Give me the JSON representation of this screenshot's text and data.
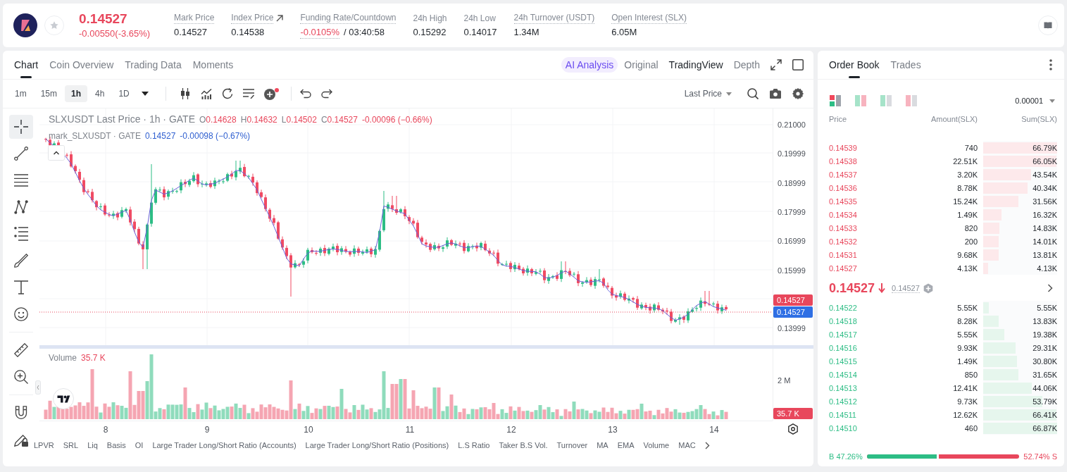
{
  "ticker": {
    "favorite": false,
    "price": "0.14527",
    "change": "-0.00550(-3.65%)",
    "stats": [
      {
        "label": "Mark Price",
        "value": "0.14527",
        "tooltip": true,
        "kind": "plain"
      },
      {
        "label": "Index Price",
        "value": "0.14538",
        "tooltip": true,
        "kind": "link"
      },
      {
        "label": "Funding Rate/Countdown",
        "rate": "-0.0105%",
        "value": "/ 03:40:58",
        "tooltip": true,
        "kind": "funding"
      },
      {
        "label": "24h High",
        "value": "0.15292",
        "tooltip": false,
        "kind": "plain"
      },
      {
        "label": "24h Low",
        "value": "0.14017",
        "tooltip": false,
        "kind": "plain"
      },
      {
        "label": "24h Turnover (USDT)",
        "value": "1.34M",
        "tooltip": true,
        "kind": "plain"
      },
      {
        "label": "Open Interest (SLX)",
        "value": "6.05M",
        "tooltip": true,
        "kind": "plain"
      }
    ]
  },
  "chart_panel": {
    "tabs": [
      {
        "label": "Chart",
        "selected": true
      },
      {
        "label": "Coin Overview",
        "selected": false
      },
      {
        "label": "Trading Data",
        "selected": false
      },
      {
        "label": "Moments",
        "selected": false
      }
    ],
    "views": [
      {
        "label": "AI Analysis",
        "kind": "ai",
        "selected": false
      },
      {
        "label": "Original",
        "kind": "plain",
        "selected": false
      },
      {
        "label": "TradingView",
        "kind": "plain",
        "selected": true
      },
      {
        "label": "Depth",
        "kind": "plain",
        "selected": false
      }
    ],
    "intervals": [
      {
        "label": "1m",
        "selected": false
      },
      {
        "label": "15m",
        "selected": false
      },
      {
        "label": "1h",
        "selected": true
      },
      {
        "label": "4h",
        "selected": false
      },
      {
        "label": "1D",
        "selected": false
      }
    ],
    "price_source": "Last Price",
    "tool_groups": [
      {
        "tools": [
          {
            "kind": "crosshair",
            "selected": true
          },
          {
            "kind": "trend_line",
            "selected": false
          },
          {
            "kind": "horizontal_lines",
            "selected": false
          },
          {
            "kind": "pattern",
            "selected": false
          },
          {
            "kind": "fib_levels",
            "selected": false
          },
          {
            "kind": "brush",
            "selected": false
          },
          {
            "kind": "text",
            "selected": false
          },
          {
            "kind": "emoji",
            "selected": false
          }
        ]
      },
      {
        "tools": [
          {
            "kind": "ruler",
            "selected": false
          },
          {
            "kind": "zoom",
            "selected": false
          }
        ]
      },
      {
        "tools": [
          {
            "kind": "magnet",
            "selected": false
          },
          {
            "kind": "lock_drawing",
            "selected": false
          }
        ]
      }
    ],
    "legend": {
      "title": "SLXUSDT Last Price · 1h · GATE",
      "ohlc": [
        {
          "key": "O",
          "value": "0.14628"
        },
        {
          "key": "H",
          "value": "0.14632"
        },
        {
          "key": "L",
          "value": "0.14502"
        },
        {
          "key": "C",
          "value": "0.14527"
        }
      ],
      "change": "-0.00096 (−0.66%)",
      "mark_title": "mark_SLXUSDT · GATE",
      "mark_value": "0.14527",
      "mark_change": "-0.00098 (−0.67%)"
    },
    "price_axis": [
      "0.21000",
      "0.19999",
      "0.18999",
      "0.17999",
      "0.16999",
      "0.15999",
      "0.13999"
    ],
    "price_tags": [
      {
        "kind": "last",
        "value": "0.14527"
      },
      {
        "kind": "mark",
        "value": "0.14527"
      }
    ],
    "volume": {
      "label": "Volume",
      "value": "35.7 K",
      "axis_label": "2 M",
      "tag": "35.7 K"
    },
    "date_axis": [
      "8",
      "9",
      "10",
      "11",
      "12",
      "13",
      "14"
    ],
    "indicators": [
      "LPVR",
      "SRL",
      "Liq",
      "Basis",
      "OI",
      "Large Trader Long/Short Ratio (Accounts)",
      "Large Trader Long/Short Ratio (Positions)",
      "L.S Ratio",
      "Taker B.S Vol.",
      "Turnover",
      "MA",
      "EMA",
      "Volume",
      "MAC"
    ]
  },
  "order_book": {
    "tabs": [
      {
        "label": "Order Book",
        "selected": true
      },
      {
        "label": "Trades",
        "selected": false
      }
    ],
    "view_modes": [
      {
        "kind": "both",
        "selected": true
      },
      {
        "kind": "columns",
        "selected": false
      },
      {
        "kind": "bids",
        "selected": false
      },
      {
        "kind": "asks",
        "selected": false
      }
    ],
    "precision": "0.00001",
    "columns": [
      "Price",
      "Amount(SLX)",
      "Sum(SLX)"
    ],
    "asks": [
      {
        "price": "0.14539",
        "amount": "740",
        "sum": "66.79K",
        "level": 0.999
      },
      {
        "price": "0.14538",
        "amount": "22.51K",
        "sum": "66.05K",
        "level": 0.988
      },
      {
        "price": "0.14537",
        "amount": "3.20K",
        "sum": "43.54K",
        "level": 0.651
      },
      {
        "price": "0.14536",
        "amount": "8.78K",
        "sum": "40.34K",
        "level": 0.603
      },
      {
        "price": "0.14535",
        "amount": "15.24K",
        "sum": "31.56K",
        "level": 0.472
      },
      {
        "price": "0.14534",
        "amount": "1.49K",
        "sum": "16.32K",
        "level": 0.244
      },
      {
        "price": "0.14533",
        "amount": "820",
        "sum": "14.83K",
        "level": 0.222
      },
      {
        "price": "0.14532",
        "amount": "200",
        "sum": "14.01K",
        "level": 0.21
      },
      {
        "price": "0.14531",
        "amount": "9.68K",
        "sum": "13.81K",
        "level": 0.207
      },
      {
        "price": "0.14527",
        "amount": "4.13K",
        "sum": "4.13K",
        "level": 0.062
      }
    ],
    "last_price": "0.14527",
    "price_falling": true,
    "mark_price": "0.14527",
    "bids": [
      {
        "price": "0.14522",
        "amount": "5.55K",
        "sum": "5.55K",
        "level": 0.075
      },
      {
        "price": "0.14518",
        "amount": "8.28K",
        "sum": "13.83K",
        "level": 0.207
      },
      {
        "price": "0.14517",
        "amount": "5.55K",
        "sum": "19.38K",
        "level": 0.29
      },
      {
        "price": "0.14516",
        "amount": "9.93K",
        "sum": "29.31K",
        "level": 0.438
      },
      {
        "price": "0.14515",
        "amount": "1.49K",
        "sum": "30.80K",
        "level": 0.461
      },
      {
        "price": "0.14514",
        "amount": "850",
        "sum": "31.65K",
        "level": 0.473
      },
      {
        "price": "0.14513",
        "amount": "12.41K",
        "sum": "44.06K",
        "level": 0.659
      },
      {
        "price": "0.14512",
        "amount": "9.73K",
        "sum": "53.79K",
        "level": 0.804
      },
      {
        "price": "0.14511",
        "amount": "12.62K",
        "sum": "66.41K",
        "level": 0.993
      },
      {
        "price": "0.14510",
        "amount": "460",
        "sum": "66.87K",
        "level": 1
      }
    ],
    "ratio": {
      "buy": "B 47.26%",
      "sell": "52.74% S",
      "level": 0.4726
    }
  }
}
